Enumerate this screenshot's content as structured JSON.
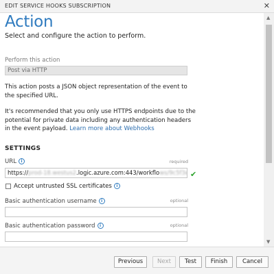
{
  "dialog": {
    "title": "EDIT SERVICE HOOKS SUBSCRIPTION",
    "close_icon": "close-icon"
  },
  "page": {
    "heading": "Action",
    "subtitle": "Select and configure the action to perform."
  },
  "perform": {
    "label": "Perform this action",
    "value": "Post via HTTP"
  },
  "description": {
    "line1": "This action posts a JSON object representation of the event to",
    "line2": "the specified URL.",
    "warn1": "It's recommended that you only use HTTPS endpoints due to the",
    "warn2": "potential for private data including any authentication headers",
    "warn3_prefix": "in the event payload. ",
    "link": "Learn more about Webhooks"
  },
  "settings": {
    "heading": "SETTINGS",
    "url": {
      "label": "URL",
      "hint": "required",
      "value_prefix": "https://",
      "value_blur1": "prod-18.westus2",
      "value_mid": ".logic.azure.com:443/workflo",
      "value_blur2": "ws/9c5f3e8a",
      "valid_icon": "check-icon"
    },
    "ssl": {
      "label": "Accept untrusted SSL certificates",
      "checked": false
    },
    "username": {
      "label": "Basic authentication username",
      "hint": "optional",
      "value": ""
    },
    "password": {
      "label": "Basic authentication password",
      "hint": "optional",
      "value": ""
    }
  },
  "buttons": {
    "previous": "Previous",
    "next": "Next",
    "test": "Test",
    "finish": "Finish",
    "cancel": "Cancel"
  },
  "colors": {
    "accent": "#2f7bbf",
    "valid": "#2da32d",
    "link": "#2d6fb0"
  }
}
